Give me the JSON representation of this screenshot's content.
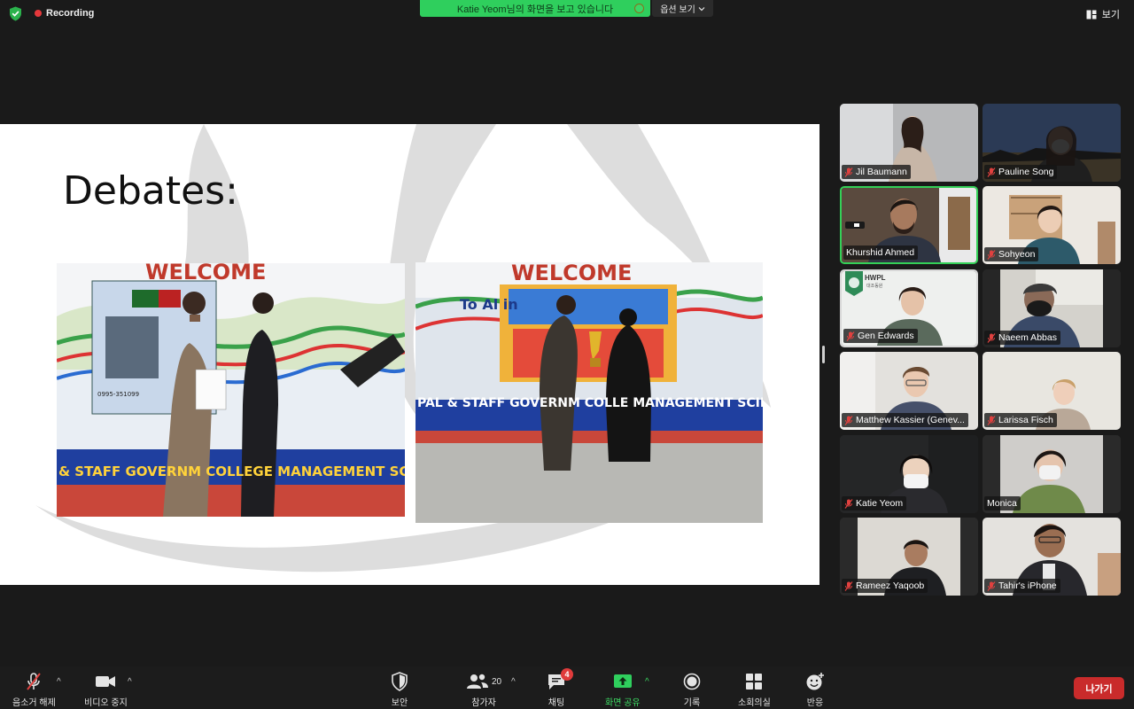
{
  "top_bar": {
    "recording_label": "Recording",
    "share_banner_text": "Katie Yeom님의 화면을 보고 있습니다",
    "options_label": "옵션 보기",
    "view_label": "보기"
  },
  "slide": {
    "title": "Debates:",
    "photo1_banner": "WELCOME",
    "photo1_bottom": "& STAFF GOVERNM COLLEGE MANAGEMENT SCIENCES HAR",
    "photo1_phone": "0995-351099",
    "photo2_banner": "WELCOME",
    "photo2_sub": "To Al in",
    "photo2_bottom": "PAL & STAFF GOVERNM COLLE MANAGEMENT SCIE"
  },
  "participants": [
    {
      "name": "Jil Baumann",
      "muted": true,
      "active": false
    },
    {
      "name": "Pauline Song",
      "muted": true,
      "active": false
    },
    {
      "name": "Khurshid Ahmed",
      "muted": false,
      "active": true
    },
    {
      "name": "Sohyeon",
      "muted": true,
      "active": false
    },
    {
      "name": "Gen Edwards",
      "muted": true,
      "active": false
    },
    {
      "name": "Naeem Abbas",
      "muted": true,
      "active": false
    },
    {
      "name": "Matthew Kassier (Genev...",
      "muted": true,
      "active": false
    },
    {
      "name": "Larissa Fisch",
      "muted": true,
      "active": false
    },
    {
      "name": "Katie Yeom",
      "muted": true,
      "active": false
    },
    {
      "name": "Monica",
      "muted": false,
      "active": false
    },
    {
      "name": "Rameez Yaqoob",
      "muted": true,
      "active": false
    },
    {
      "name": "Tahir's iPhone",
      "muted": true,
      "active": false
    }
  ],
  "gen_logo_text": "HWPL",
  "gen_logo_sub": "대조동원",
  "toolbar": {
    "unmute_label": "음소거 해제",
    "stop_video_label": "비디오 중지",
    "security_label": "보안",
    "participants_label": "참가자",
    "participants_count": "20",
    "chat_label": "채팅",
    "chat_badge": "4",
    "share_label": "화면 공유",
    "record_label": "기록",
    "breakout_label": "소회의실",
    "reactions_label": "반응",
    "leave_label": "나가기"
  },
  "colors": {
    "share_green": "#2fcf5d",
    "leave_red": "#c92b2b",
    "active_border": "#33d057",
    "toolbar_bg": "#1c1c1c"
  }
}
